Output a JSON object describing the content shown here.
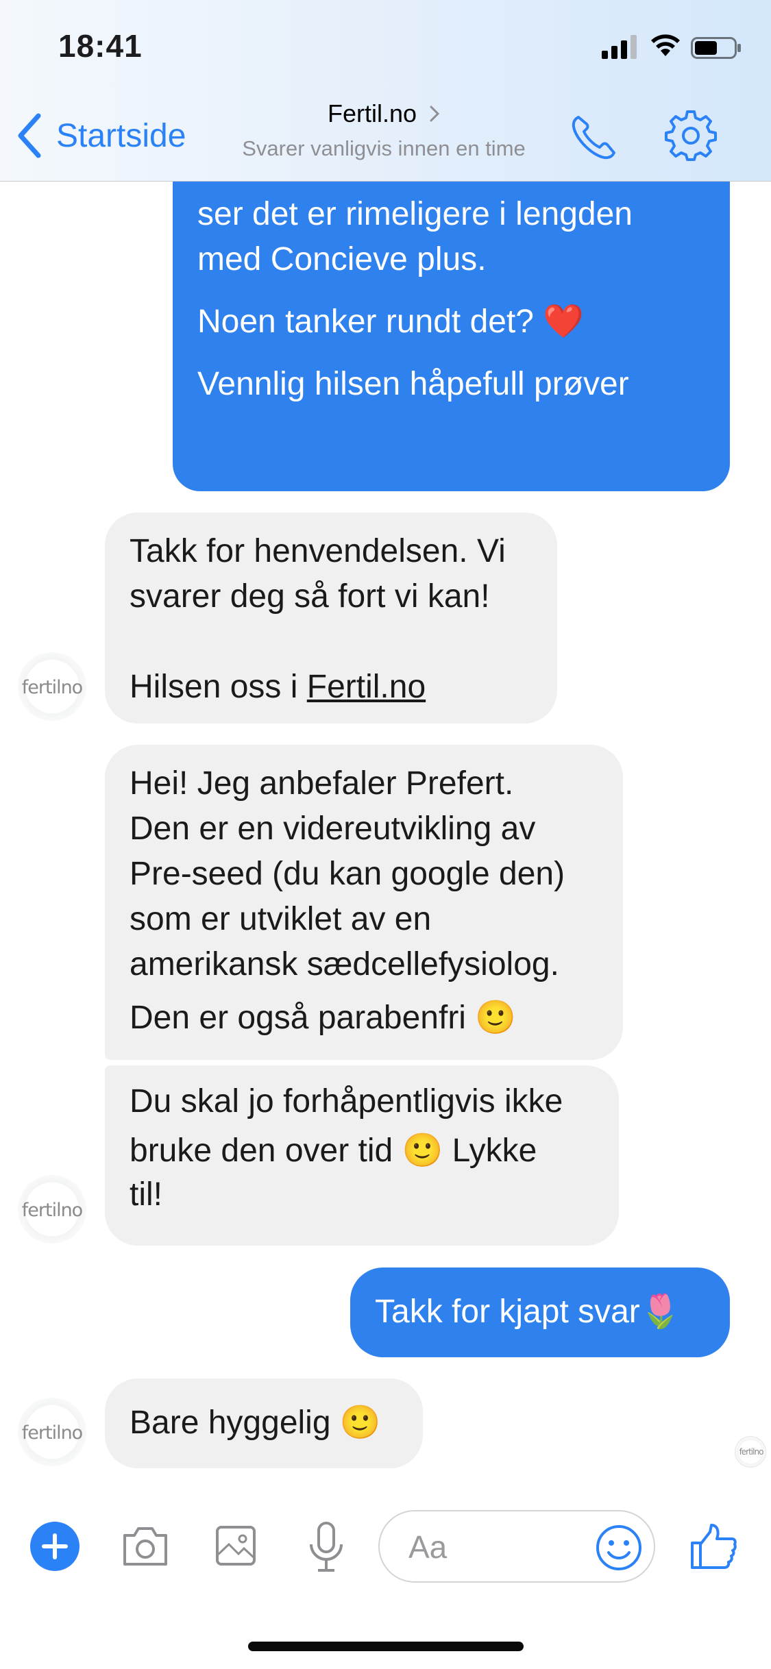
{
  "status": {
    "time": "18:41"
  },
  "header": {
    "back_label": "Startside",
    "title": "Fertil.no",
    "subtitle": "Svarer vanligvis innen en time"
  },
  "avatar_label": "fertilno",
  "messages": [
    {
      "dir": "out",
      "lines": [
        "ser det er rimeligere i lengden",
        "med Concieve plus.",
        "",
        "Noen tanker rundt det? ❤️",
        "",
        "Vennlig hilsen håpefull prøver"
      ]
    },
    {
      "dir": "in",
      "lines": [
        "Takk for henvendelsen. Vi",
        "svarer deg så fort vi kan!",
        "",
        "Hilsen oss i "
      ],
      "link": "Fertil.no"
    },
    {
      "dir": "in",
      "lines": [
        "Hei! Jeg anbefaler Prefert.",
        "Den er en videreutvikling av",
        "Pre-seed (du kan google den)",
        "som er utviklet av en",
        "amerikansk sædcellefysiolog.",
        "Den er også parabenfri 🙂"
      ]
    },
    {
      "dir": "in",
      "lines": [
        "Du skal jo forhåpentligvis ikke",
        "bruke den over tid 🙂 Lykke",
        "til!"
      ]
    },
    {
      "dir": "out",
      "lines": [
        "Takk for kjapt svar🌷"
      ]
    },
    {
      "dir": "in",
      "lines": [
        "Bare hyggelig 🙂"
      ]
    }
  ],
  "composer": {
    "placeholder": "Aa"
  },
  "colors": {
    "accent": "#2b82f6",
    "outgoing": "#2f81ee",
    "incoming": "#f0f0f0"
  }
}
